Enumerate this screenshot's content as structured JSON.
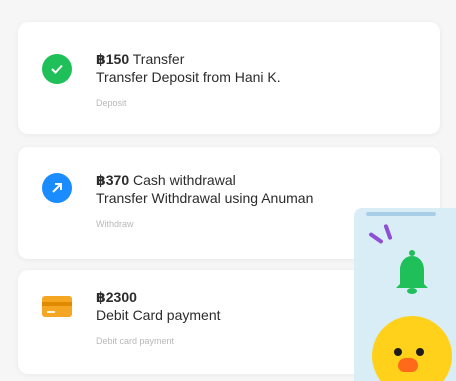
{
  "transactions": [
    {
      "amount": "฿150",
      "type": "Transfer",
      "description": "Transfer Deposit from Hani K.",
      "category": "Deposit",
      "icon": "check-icon",
      "color": "#1fbf5a"
    },
    {
      "amount": "฿370",
      "type": "Cash withdrawal",
      "description": "Transfer Withdrawal using Anuman",
      "category": "Withdraw",
      "icon": "arrow-icon",
      "color": "#1a8cff"
    },
    {
      "amount": "฿2300",
      "type": "",
      "description": "Debit Card payment",
      "category": "Debit card payment",
      "icon": "credit-card-icon",
      "color": "#f5a623"
    }
  ],
  "widget": {
    "bell_color": "#1fbf5a",
    "background": "#d9edf7"
  }
}
